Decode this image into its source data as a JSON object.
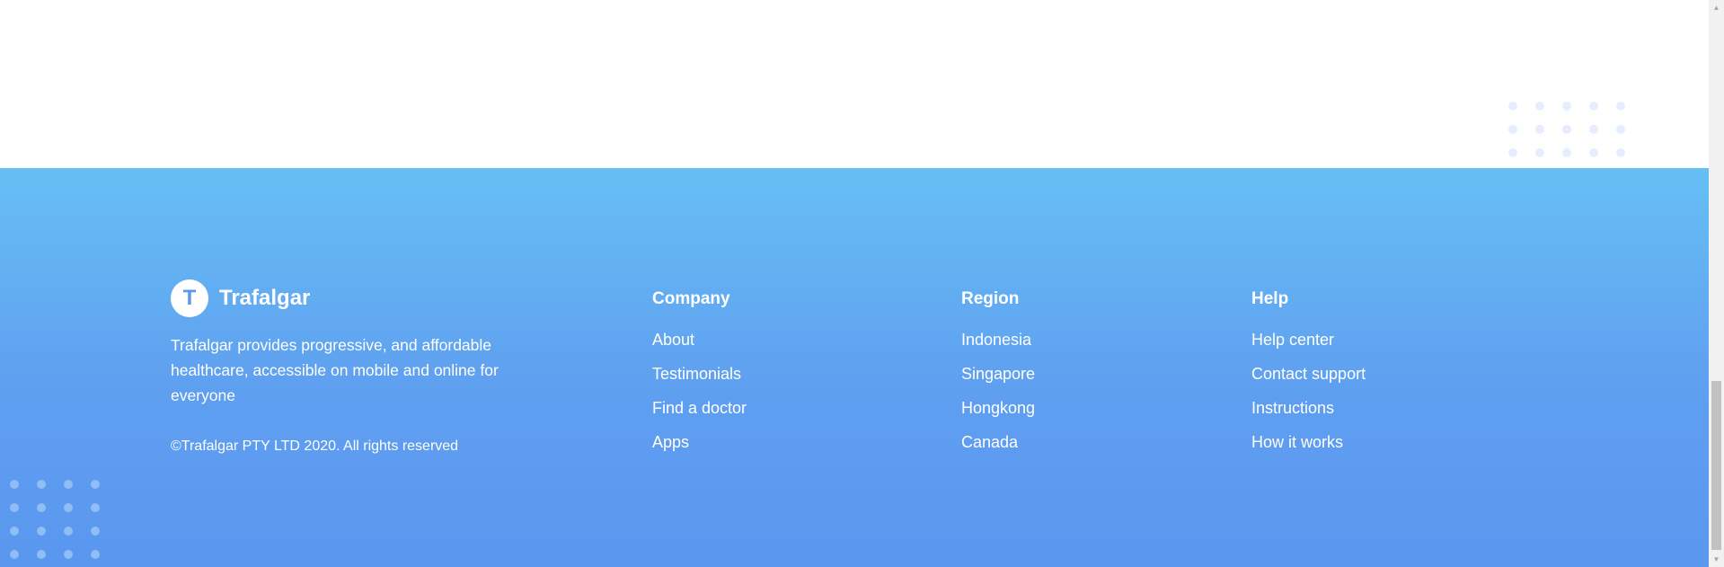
{
  "brand": {
    "logo_letter": "T",
    "name": "Trafalgar",
    "description": "Trafalgar provides progressive, and affordable healthcare, accessible on mobile and online for everyone",
    "copyright": "©Trafalgar PTY LTD 2020. All rights reserved"
  },
  "columns": [
    {
      "title": "Company",
      "links": [
        "About",
        "Testimonials",
        "Find a doctor",
        "Apps"
      ]
    },
    {
      "title": "Region",
      "links": [
        "Indonesia",
        "Singapore",
        "Hongkong",
        "Canada"
      ]
    },
    {
      "title": "Help",
      "links": [
        "Help center",
        "Contact support",
        "Instructions",
        "How it works"
      ]
    }
  ],
  "colors": {
    "footer_gradient_top": "#67bff4",
    "footer_gradient_bottom": "#5a97ef",
    "text": "#ffffff",
    "dots_light": "#e5eefc",
    "dots_on_footer": "#8fbdf5"
  },
  "icons": {
    "scroll_up": "triangle-up-icon",
    "scroll_down": "triangle-down-icon"
  }
}
